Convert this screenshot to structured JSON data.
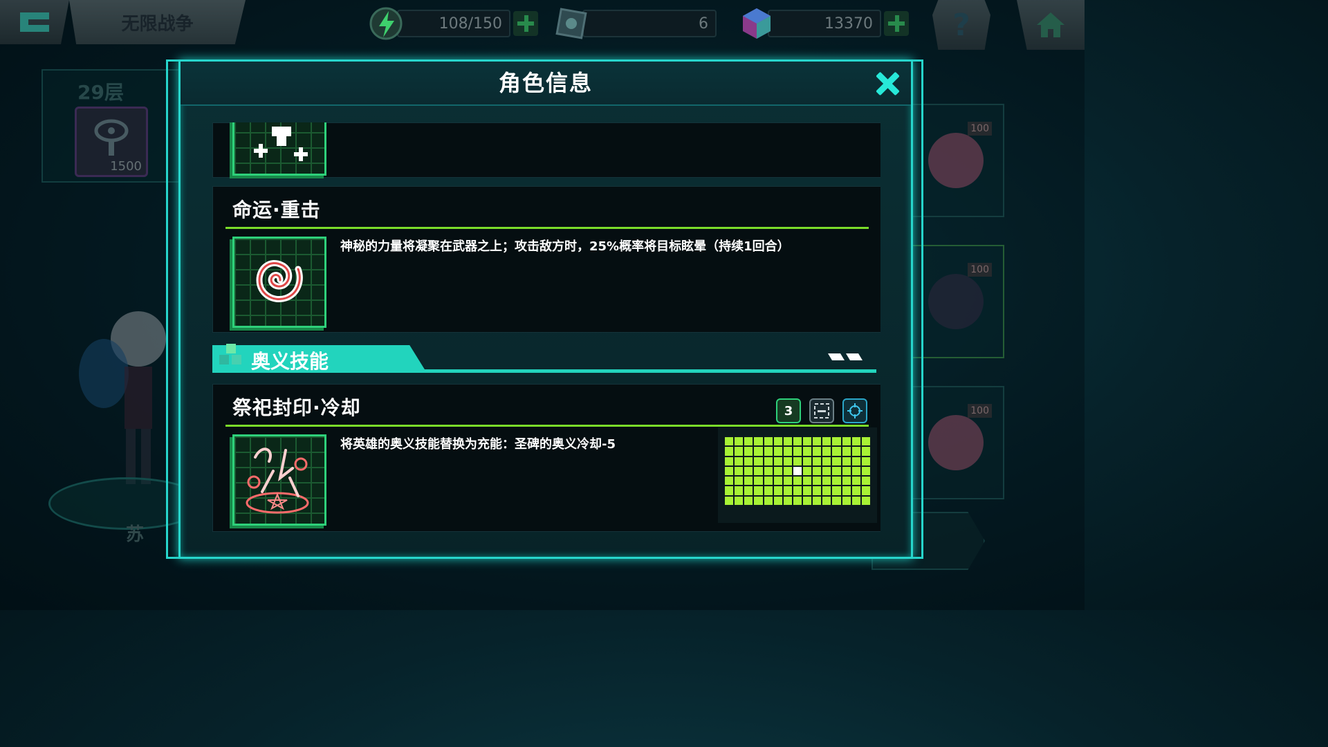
{
  "topbar": {
    "mode_title": "无限战争",
    "energy": "108/150",
    "ticket": "6",
    "gems": "13370",
    "help": "?"
  },
  "background": {
    "floor": "29层",
    "item_count": "1500",
    "hero_name": "苏",
    "levels": [
      "100",
      "100",
      "100"
    ]
  },
  "modal": {
    "title": "角色信息",
    "skills": [
      {
        "name": "命运·重击",
        "description": "神秘的力量将凝聚在武器之上；攻击敌方时，25%概率将目标眩晕（持续1回合）"
      }
    ],
    "section_title": "奥义技能",
    "ultimate": {
      "name": "祭祀封印·冷却",
      "description": "将英雄的奥义技能替换为充能：圣碑的奥义冷却-5",
      "badge_number": "3",
      "range_grid": {
        "cols": 15,
        "rows": 7,
        "center": [
          7,
          3
        ]
      }
    }
  },
  "colors": {
    "accent": "#27d6cc",
    "green_rule": "#7bdc2a",
    "grid": "#a8f235"
  }
}
